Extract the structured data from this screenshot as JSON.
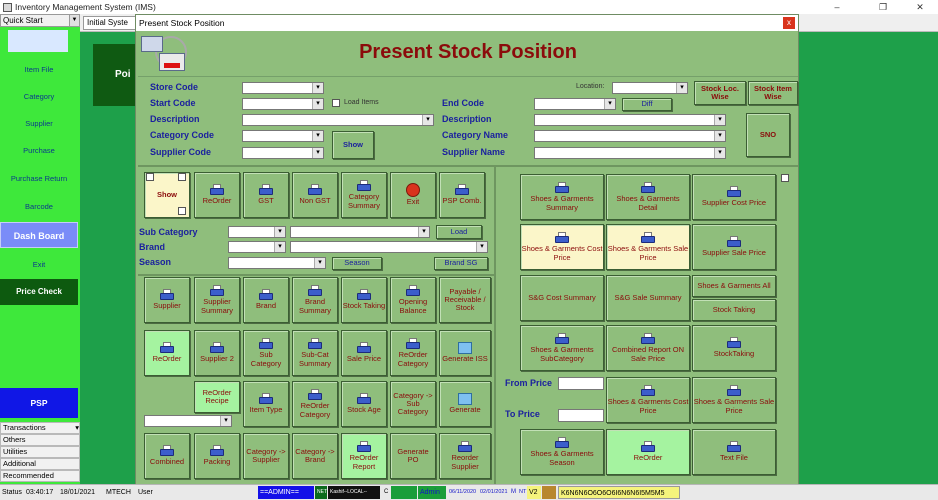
{
  "app": {
    "title": "Inventory Management System (IMS)",
    "window_controls": [
      "–",
      "❐",
      "✕"
    ]
  },
  "sidebar": {
    "quick_start": "Quick Start",
    "items": [
      "Item File",
      "Category",
      "Supplier",
      "Purchase",
      "Purchase Return",
      "Barcode",
      "Dash Board",
      "Exit",
      "Price Check",
      "PSP"
    ],
    "accordion": [
      "Transactions",
      "Others",
      "Utilities",
      "Additional",
      "Recommended"
    ]
  },
  "tabs": {
    "first": "Initial Syste"
  },
  "background_panel": {
    "label": "Poi"
  },
  "dialog": {
    "title": "Present Stock Position",
    "close": "x",
    "header_title": "Present Stock Position"
  },
  "filters": {
    "store_code": "Store Code",
    "start_code": "Start Code",
    "description": "Description",
    "category_code": "Category Code",
    "supplier_code": "Supplier Code",
    "load_items": "Load Items",
    "show": "Show",
    "location": "Location:",
    "end_code": "End Code",
    "description2": "Description",
    "category_name": "Category Name",
    "supplier_name": "Supplier Name",
    "diff": "Diff",
    "stock_loc_wise": "Stock Loc. Wise",
    "stock_item_wise": "Stock Item Wise",
    "sno": "SNO"
  },
  "toolbar1": [
    "Show",
    "ReOrder",
    "GST",
    "Non GST",
    "Category Summary",
    "Exit",
    "PSP Comb."
  ],
  "subfilters": {
    "sub_category": "Sub Category",
    "brand": "Brand",
    "season": "Season",
    "load": "Load",
    "season_btn": "Season",
    "brand_sg": "Brand SG"
  },
  "grid_left": {
    "row1": [
      "Supplier",
      "Supplier Summary",
      "Brand",
      "Brand Summary",
      "Stock Taking",
      "Opening Balance",
      "Payable / Receivable / Stock"
    ],
    "row2": [
      "ReOrder",
      "Supplier 2",
      "Sub Category",
      "Sub-Cat Summary",
      "Sale Price",
      "ReOrder Category",
      "Generate ISS"
    ],
    "row3": [
      "ReOrder Recipe",
      "Item Type",
      "ReOrder Category",
      "Stock Age",
      "Category -> Sub Category",
      "Generate"
    ],
    "row4": [
      "Combined",
      "Packing",
      "Category -> Supplier",
      "Category -> Brand",
      "ReOrder Report",
      "Generate PO",
      "Reorder Supplier"
    ]
  },
  "grid_right": {
    "r1": [
      "Shoes & Garments Summary",
      "Shoes & Garments Detail",
      "Supplier Cost Price"
    ],
    "r2": [
      "Shoes & Garments Cost Price",
      "Shoes & Garments Sale Price",
      "Supplier Sale Price"
    ],
    "r3": [
      "S&G Cost Summary",
      "S&G Sale Summary",
      "Shoes & Garments All",
      "Stock Taking"
    ],
    "r4": [
      "Shoes & Garments SubCategory",
      "Combined Report ON Sale Price",
      "StockTaking"
    ],
    "from_price": "From Price",
    "to_price": "To Price",
    "r5": [
      "Shoes & Garments Cost Price",
      "Shoes & Garments Sale Price"
    ],
    "r6": [
      "Shoes & Garments Season",
      "ReOrder",
      "Text File"
    ]
  },
  "status": {
    "label": "Status",
    "time": "03:40:17",
    "date": "18/01/2021",
    "machine": "MTECH",
    "user": "User",
    "admin": "==ADMIN==",
    "net": "NET",
    "server": "Kashif--LOCAL--",
    "c": "C",
    "blank": "",
    "admin2": "Admin",
    "d1": "06/11/2020",
    "d2": "02/01/2021",
    "m": "M",
    "nt": "NT",
    "v2": "V2",
    "code": "K6N6N6O6O6O6I6N6N6I5M5M5"
  }
}
